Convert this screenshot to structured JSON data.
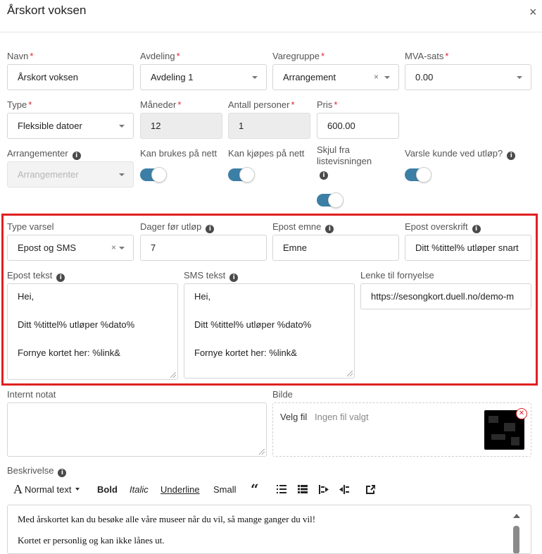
{
  "header": {
    "title": "Årskort voksen",
    "close_label": "×"
  },
  "row1": {
    "navn": {
      "label": "Navn",
      "value": "Årskort voksen"
    },
    "avdeling": {
      "label": "Avdeling",
      "value": "Avdeling 1"
    },
    "varegruppe": {
      "label": "Varegruppe",
      "value": "Arrangement"
    },
    "mva": {
      "label": "MVA-sats",
      "value": "0.00"
    }
  },
  "row2": {
    "type": {
      "label": "Type",
      "value": "Fleksible datoer"
    },
    "maneder": {
      "label": "Måneder",
      "value": "12"
    },
    "antall": {
      "label": "Antall personer",
      "value": "1"
    },
    "pris": {
      "label": "Pris",
      "value": "600.00"
    }
  },
  "row3": {
    "arrangementer": {
      "label": "Arrangementer",
      "placeholder": "Arrangementer"
    },
    "kan_brukes": {
      "label": "Kan brukes på nett",
      "on": true
    },
    "kan_kjopes": {
      "label": "Kan kjøpes på nett",
      "on": true
    },
    "skjul": {
      "label_line1": "Skjul fra",
      "label_line2": "listevisningen",
      "on": true
    },
    "varsle": {
      "label": "Varsle kunde ved utløp?",
      "on": true
    }
  },
  "notify": {
    "type_varsel": {
      "label": "Type varsel",
      "value": "Epost og SMS"
    },
    "dager": {
      "label": "Dager før utløp",
      "value": "7"
    },
    "epost_emne": {
      "label": "Epost emne",
      "value": "Emne"
    },
    "epost_overskrift": {
      "label": "Epost overskrift",
      "value": "Ditt %tittel% utløper snart"
    },
    "epost_tekst": {
      "label": "Epost tekst",
      "lines": [
        "Hei,",
        "Ditt %tittel% utløper %dato%",
        "Fornye kortet her: %link&"
      ]
    },
    "sms_tekst": {
      "label": "SMS tekst",
      "lines": [
        "Hei,",
        "Ditt %tittel% utløper %dato%",
        "Fornye kortet her: %link&"
      ]
    },
    "lenke": {
      "label": "Lenke til fornyelse",
      "value": "https://sesongkort.duell.no/demo-m"
    }
  },
  "internt_notat": {
    "label": "Internt notat",
    "value": ""
  },
  "bilde": {
    "label": "Bilde",
    "button": "Velg fil",
    "status": "Ingen fil valgt"
  },
  "beskrivelse": {
    "label": "Beskrivelse",
    "toolbar": {
      "format": "Normal text",
      "bold": "Bold",
      "italic": "Italic",
      "underline": "Underline",
      "small": "Small"
    },
    "paragraphs": [
      "Med årskortet kan du besøke alle våre museer når du vil, så mange ganger du vil!",
      "Kortet er personlig og kan ikke lånes ut."
    ]
  },
  "colors": {
    "required": "#e0232b",
    "toggle": "#3c7fa6",
    "highlight": "#e02020"
  }
}
